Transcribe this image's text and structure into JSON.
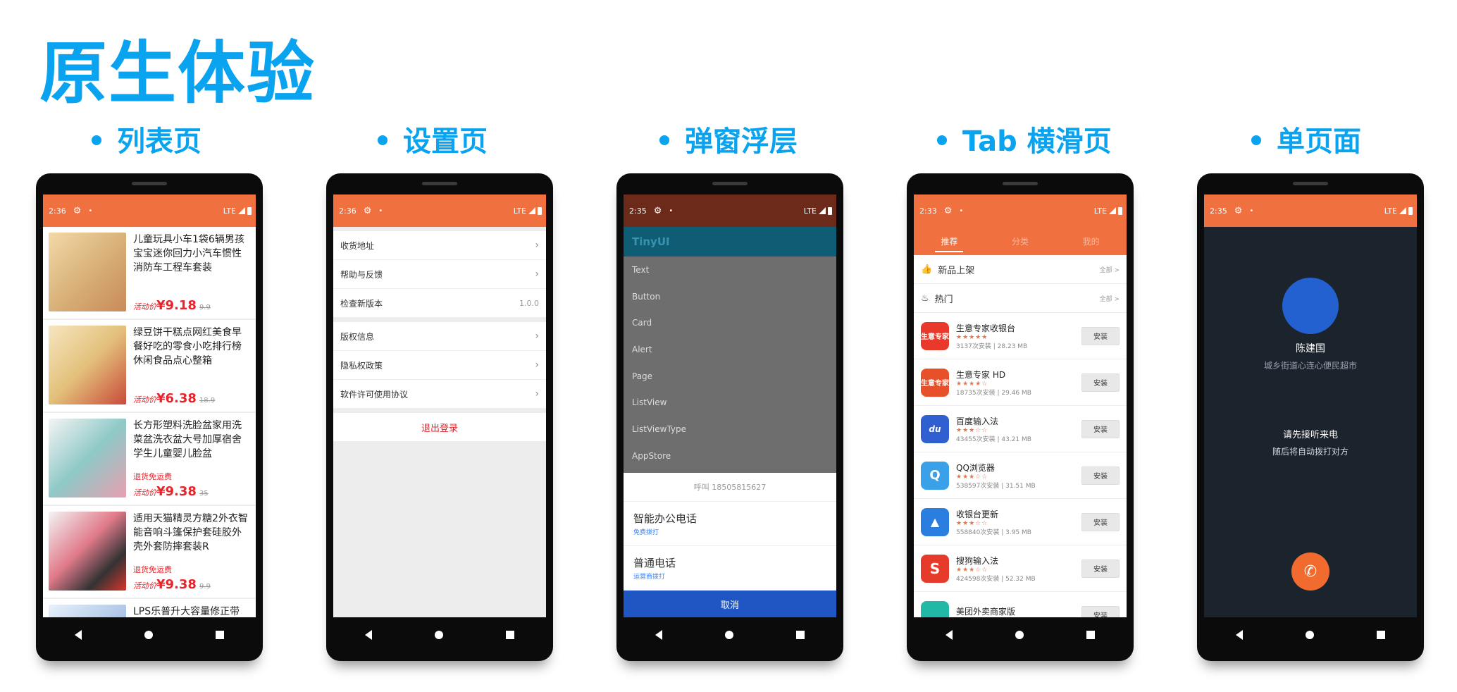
{
  "page_title": "原生体验",
  "columns": [
    {
      "title": "列表页"
    },
    {
      "title": "设置页"
    },
    {
      "title": "弹窗浮层"
    },
    {
      "title": "Tab 横滑页"
    },
    {
      "title": "单页面"
    }
  ],
  "status_times": [
    "2:36",
    "2:36",
    "2:35",
    "2:33",
    "2:35"
  ],
  "status_network": "LTE",
  "list_page": {
    "products": [
      {
        "title": "儿童玩具小车1袋6辆男孩宝宝迷你回力小汽车惯性消防车工程车套装",
        "tag": "",
        "promo": "活动价",
        "price": "¥9.18",
        "old_price": "9.9",
        "img_color": "#d9b27a"
      },
      {
        "title": "绿豆饼干糕点网红美食早餐好吃的零食小吃排行榜休闲食品点心整箱",
        "tag": "",
        "promo": "活动价",
        "price": "¥6.38",
        "old_price": "18.9",
        "img_color": "#e3c07a"
      },
      {
        "title": "长方形塑料洗脸盆家用洗菜盆洗衣盆大号加厚宿舍学生儿童婴儿脸盆",
        "tag": "退货免运费",
        "promo": "活动价",
        "price": "¥9.38",
        "old_price": "35",
        "img_color": "#8fc9c7"
      },
      {
        "title": "适用天猫精灵方糖2外衣智能音响斗篷保护套硅胶外壳外套防摔套装R",
        "tag": "退货免运费",
        "promo": "活动价",
        "price": "¥9.38",
        "old_price": "9.9",
        "img_color": "#e07a8a"
      },
      {
        "title": "LPS乐普升大容量修正带 学生涂改带改正错带 办公用",
        "tag": "",
        "promo": "",
        "price": "",
        "old_price": "",
        "img_color": "#9dbbe0"
      }
    ]
  },
  "settings_page": {
    "group1": [
      {
        "label": "收货地址"
      },
      {
        "label": "帮助与反馈"
      },
      {
        "label": "检查新版本",
        "value": "1.0.0"
      }
    ],
    "group2": [
      {
        "label": "版权信息"
      },
      {
        "label": "隐私权政策"
      },
      {
        "label": "软件许可使用协议"
      }
    ],
    "logout": "退出登录"
  },
  "popup_page": {
    "app_title": "TinyUI",
    "menu": [
      "Text",
      "Button",
      "Card",
      "Alert",
      "Page",
      "ListView",
      "ListViewType",
      "AppStore"
    ],
    "sheet_title": "呼叫 18505815627",
    "options": [
      {
        "main": "智能办公电话",
        "sub": "免费拨打"
      },
      {
        "main": "普通电话",
        "sub": "运营商拨打"
      }
    ],
    "cancel": "取消"
  },
  "tab_page": {
    "tabs": [
      "推荐",
      "分类",
      "我的"
    ],
    "sections": [
      {
        "label": "新品上架",
        "all": "全部 >"
      },
      {
        "label": "热门",
        "all": "全部 >"
      }
    ],
    "install_label": "安装",
    "apps": [
      {
        "name": "生意专家收银台",
        "stars": "★★★★★",
        "meta": "3137次安装 | 28.23 MB",
        "icon_text": "生意专家",
        "icon_color": "#e8392a"
      },
      {
        "name": "生意专家 HD",
        "stars": "★★★★☆",
        "meta": "18735次安装 | 29.46 MB",
        "icon_text": "生意专家",
        "icon_color": "#e8502a"
      },
      {
        "name": "百度输入法",
        "stars": "★★★☆☆",
        "meta": "43455次安装 | 43.21 MB",
        "icon_text": "du",
        "icon_color": "#2f5fd0"
      },
      {
        "name": "QQ浏览器",
        "stars": "★★★☆☆",
        "meta": "538597次安装 | 31.51 MB",
        "icon_text": "Q",
        "icon_color": "#3aa0e8"
      },
      {
        "name": "收银台更新",
        "stars": "★★★☆☆",
        "meta": "558840次安装 | 3.95 MB",
        "icon_text": "▲",
        "icon_color": "#2a7ee0"
      },
      {
        "name": "搜狗输入法",
        "stars": "★★★☆☆",
        "meta": "424598次安装 | 52.32 MB",
        "icon_text": "S",
        "icon_color": "#e63a2a"
      },
      {
        "name": "美团外卖商家版",
        "stars": "★★☆☆☆",
        "meta": "",
        "icon_text": "",
        "icon_color": "#22b8a6"
      }
    ]
  },
  "call_page": {
    "name": "陈建国",
    "location": "城乡街道心连心便民超市",
    "hint": "请先接听来电",
    "sub": "随后将自动拨打对方"
  },
  "colors": {
    "accent": "#0aa3f0",
    "status_bar": "#f07040",
    "price_red": "#e8242c",
    "call_bg": "#1b232d",
    "popup_cancel": "#1f56c4"
  },
  "icons": [
    "gear-icon",
    "back-nav-icon",
    "home-nav-icon",
    "recent-nav-icon",
    "chevron-right-icon",
    "thumb-up-icon",
    "fire-icon",
    "hangup-phone-icon"
  ]
}
